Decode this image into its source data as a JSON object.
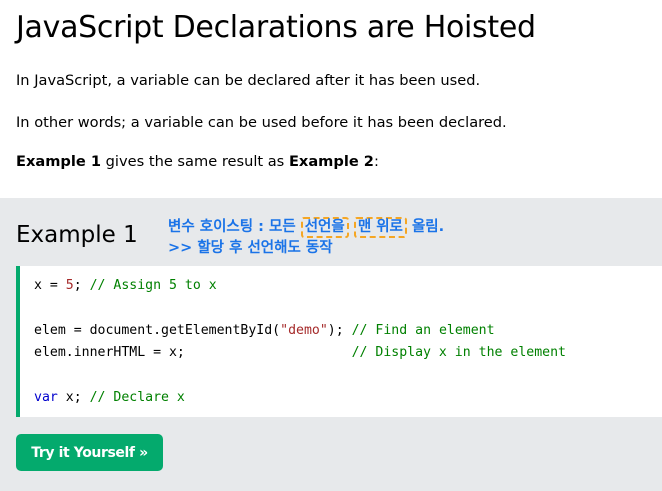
{
  "page": {
    "title": "JavaScript Declarations are Hoisted",
    "para1": "In JavaScript, a variable can be declared after it has been used.",
    "para2": "In other words; a variable can be used before it has been declared.",
    "para3": {
      "bold1": "Example 1",
      "mid": " gives the same result as ",
      "bold2": "Example 2",
      "end": ":"
    }
  },
  "example": {
    "heading": "Example 1",
    "annotation": {
      "line1_a": "변수 호이스팅 :  모든 ",
      "line1_box1": "선언을",
      "line1_box2": "맨 위로",
      "line1_end": " 올림.",
      "line2": ">> 할당 후 선언해도 동작"
    },
    "code": {
      "l1_code": "x = ",
      "l1_num": "5",
      "l1_semi": "; ",
      "l1_comment": "// Assign 5 to x",
      "l2_code": "elem = document.getElementById(",
      "l2_str": "\"demo\"",
      "l2_close": "); ",
      "l2_comment": "// Find an element",
      "l3_code": "elem.innerHTML = x;                     ",
      "l3_comment": "// Display x in the element",
      "l4_kw": "var",
      "l4_code": " x; ",
      "l4_comment": "// Declare x"
    },
    "button_label": "Try it Yourself »"
  },
  "colors": {
    "accent_green": "#04aa6d",
    "panel_bg": "#e7e9eb",
    "annotation_blue": "#1a73e8",
    "annotation_box": "#f5a623",
    "code_comment": "#008000",
    "code_string": "#a52a2a",
    "code_keyword": "#0000cd"
  }
}
